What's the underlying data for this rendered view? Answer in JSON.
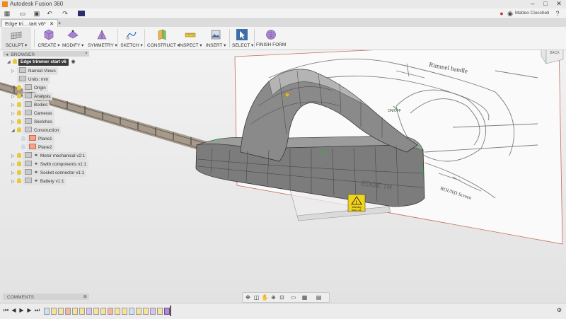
{
  "window": {
    "title": "Autodesk Fusion 360",
    "minimize": "–",
    "maximize": "□",
    "close": "✕"
  },
  "app_toolbar": {
    "user_name": "Matteo Cioccheti",
    "help": "?"
  },
  "tabs": [
    {
      "label": "Edge tri....tart v6*",
      "close": "✕"
    },
    {
      "label": "+"
    }
  ],
  "ribbon": {
    "workspace": "SCULPT ▾",
    "groups": [
      {
        "label": "CREATE ▾",
        "icon": "create-cube-icon"
      },
      {
        "label": "MODIFY ▾",
        "icon": "modify-icon"
      },
      {
        "label": "SYMMETRY ▾",
        "icon": "symmetry-icon"
      },
      {
        "label": "SKETCH ▾",
        "icon": "sketch-icon"
      },
      {
        "label": "CONSTRUCT ▾",
        "icon": "construct-icon"
      },
      {
        "label": "INSPECT ▾",
        "icon": "inspect-icon"
      },
      {
        "label": "INSERT ▾",
        "icon": "insert-icon"
      },
      {
        "label": "SELECT ▾",
        "icon": "select-icon"
      },
      {
        "label": "FINISH FORM",
        "icon": "finish-form-icon"
      }
    ]
  },
  "browser": {
    "title": "BROWSER",
    "root": "Edge trimmer start v6",
    "nodes": [
      {
        "label": "Named Views"
      },
      {
        "label": "Units: mm"
      },
      {
        "label": "Origin"
      },
      {
        "label": "Analysis"
      },
      {
        "label": "Bodies"
      },
      {
        "label": "Cameras"
      },
      {
        "label": "Sketches"
      },
      {
        "label": "Construction"
      },
      {
        "label": "Plane1"
      },
      {
        "label": "Plane2"
      },
      {
        "label": "Motor mechanical v2:1"
      },
      {
        "label": "Swith components v1:1"
      },
      {
        "label": "Socket connector v1:1"
      },
      {
        "label": "Battery v1:1"
      }
    ]
  },
  "viewcube": {
    "face": "BACK"
  },
  "canvas": {
    "sketch_notes": [
      "Rimmel handle",
      "ON/OFF",
      "ROUND Screen"
    ],
    "body_label": "EDGE TR",
    "warning_label": "Warning",
    "warning_sub": "Battery side"
  },
  "comments": {
    "title": "COMMENTS"
  },
  "colors": {
    "accent": "#f08a1c",
    "body": "#7a7a7a",
    "select": "#2a6fd6"
  }
}
